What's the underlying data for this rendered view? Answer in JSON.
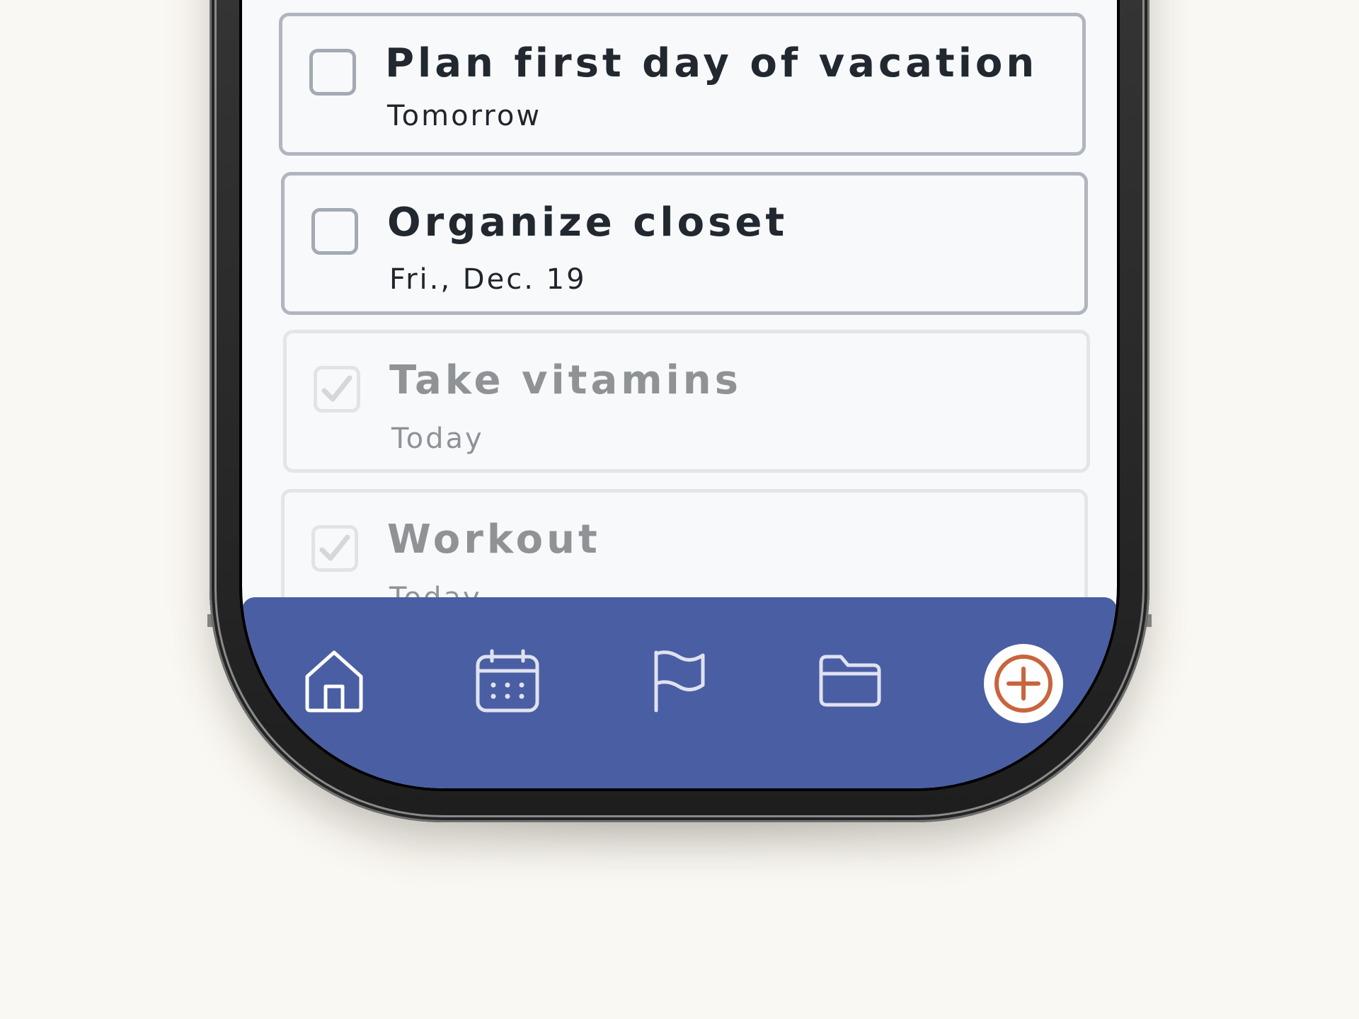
{
  "colors": {
    "accent": "#4a5ea3",
    "add_button_ring": "#c8653e",
    "text_primary": "#22282f",
    "text_completed": "#8f9396"
  },
  "tasks": [
    {
      "title": "Plan first day of vacation",
      "subtitle": "Tomorrow",
      "completed": false
    },
    {
      "title": "Organize closet",
      "subtitle": "Fri., Dec. 19",
      "completed": false
    },
    {
      "title": "Take vitamins",
      "subtitle": "Today",
      "completed": true
    },
    {
      "title": "Workout",
      "subtitle": "Today",
      "completed": true
    }
  ],
  "nav": {
    "items": [
      {
        "icon": "home-icon"
      },
      {
        "icon": "calendar-icon"
      },
      {
        "icon": "flag-icon"
      },
      {
        "icon": "folder-icon"
      },
      {
        "icon": "plus-icon"
      }
    ]
  }
}
